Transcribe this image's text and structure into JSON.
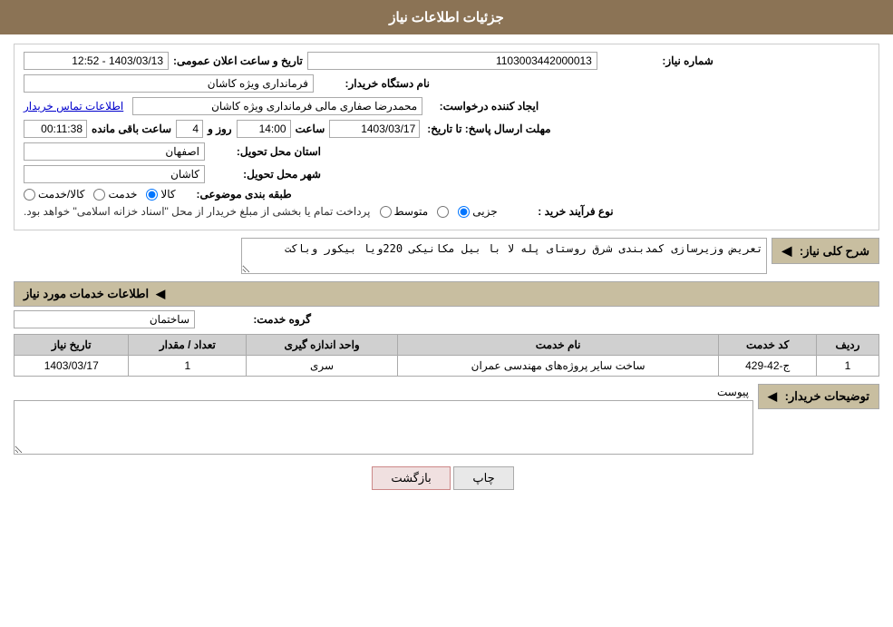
{
  "header": {
    "title": "جزئیات اطلاعات نیاز"
  },
  "fields": {
    "need_number_label": "شماره نیاز:",
    "need_number_value": "1103003442000013",
    "buyer_org_label": "نام دستگاه خریدار:",
    "buyer_org_value": "فرمانداری ویژه کاشان",
    "creator_label": "ایجاد کننده درخواست:",
    "creator_value": "محمدرضا صفاری مالی فرمانداری ویژه کاشان",
    "creator_link": "اطلاعات تماس خریدار",
    "deadline_label": "مهلت ارسال پاسخ: تا تاریخ:",
    "deadline_date": "1403/03/17",
    "deadline_time_label": "ساعت",
    "deadline_time": "14:00",
    "deadline_days_label": "روز و",
    "deadline_days": "4",
    "deadline_remaining_label": "ساعت باقی مانده",
    "deadline_remaining": "00:11:38",
    "announce_label": "تاریخ و ساعت اعلان عمومی:",
    "announce_value": "1403/03/13 - 12:52",
    "province_label": "استان محل تحویل:",
    "province_value": "اصفهان",
    "city_label": "شهر محل تحویل:",
    "city_value": "کاشان",
    "category_label": "طبقه بندی موضوعی:",
    "category_options": [
      "کالا",
      "خدمت",
      "کالا/خدمت"
    ],
    "category_selected": "کالا",
    "purchase_type_label": "نوع فرآیند خرید :",
    "purchase_options": [
      "جزیی",
      "متوسط",
      "پرداخت تمام یا بخشی از مبلغ خریدار از محل \"اسناد خزانه اسلامی\" خواهد بود."
    ],
    "purchase_selected": "جزیی",
    "purchase_note": "پرداخت تمام یا بخشی از مبلغ خریدار از محل \"اسناد خزانه اسلامی\" خواهد بود.",
    "need_desc_label": "شرح کلی نیاز:",
    "need_desc_value": "تعریض وزیرسازی کمدبندی شرق روستای پله لا با بیل مکانیکی 220ویا بیکور وباکت",
    "services_label": "اطلاعات خدمات مورد نیاز",
    "group_label": "گروه خدمت:",
    "group_value": "ساختمان",
    "table_headers": [
      "ردیف",
      "کد خدمت",
      "نام خدمت",
      "واحد اندازه گیری",
      "تعداد / مقدار",
      "تاریخ نیاز"
    ],
    "table_rows": [
      {
        "row": "1",
        "service_code": "ج-42-429",
        "service_name": "ساخت سایر پروژه‌های مهندسی عمران",
        "unit": "سری",
        "quantity": "1",
        "date": "1403/03/17"
      }
    ],
    "buyer_desc_label": "توضیحات خریدار:",
    "attachment_label": "پیوست",
    "attachment_value": "",
    "btn_print": "چاپ",
    "btn_back": "بازگشت"
  }
}
